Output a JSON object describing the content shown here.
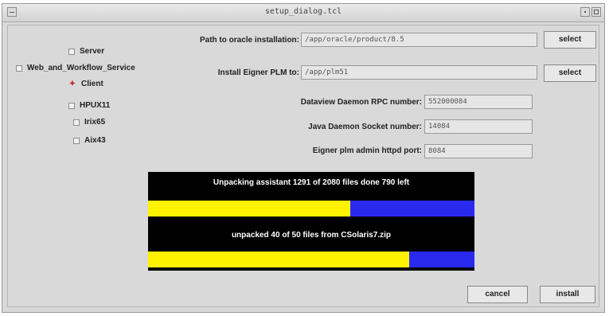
{
  "window": {
    "title": "setup_dialog.tcl"
  },
  "options": [
    {
      "label": "Server",
      "kind": "checkbox"
    },
    {
      "label": "Web_and_Workflow_Service",
      "kind": "checkbox"
    },
    {
      "label": "Client",
      "kind": "radio",
      "selected": true
    },
    {
      "label": "HPUX11",
      "kind": "checkbox"
    },
    {
      "label": "Irix65",
      "kind": "checkbox"
    },
    {
      "label": "Aix43",
      "kind": "checkbox"
    }
  ],
  "form": {
    "oracle_label": "Path to oracle installation:",
    "oracle_value": "/app/oracle/product/8.5",
    "plm_label": "Install Eigner PLM to:",
    "plm_value": "/app/plm51",
    "rpc_label": "Dataview Daemon RPC number:",
    "rpc_value": "552000084",
    "socket_label": "Java Daemon Socket number:",
    "socket_value": "14084",
    "httpd_label": "Eigner plm admin httpd port:",
    "httpd_value": "8084"
  },
  "buttons": {
    "select": "select",
    "cancel": "cancel",
    "install": "install"
  },
  "progress": {
    "line1": "Unpacking assistant 1291 of 2080 files done 790 left",
    "line2": "unpacked 40 of 50 files from CSolaris7.zip",
    "bar1_fraction": 0.62,
    "bar2_fraction": 0.8
  },
  "colors": {
    "bar_fill": "#fff200",
    "bar_track": "#2a2aee",
    "radio_mark": "#c22a2a"
  }
}
